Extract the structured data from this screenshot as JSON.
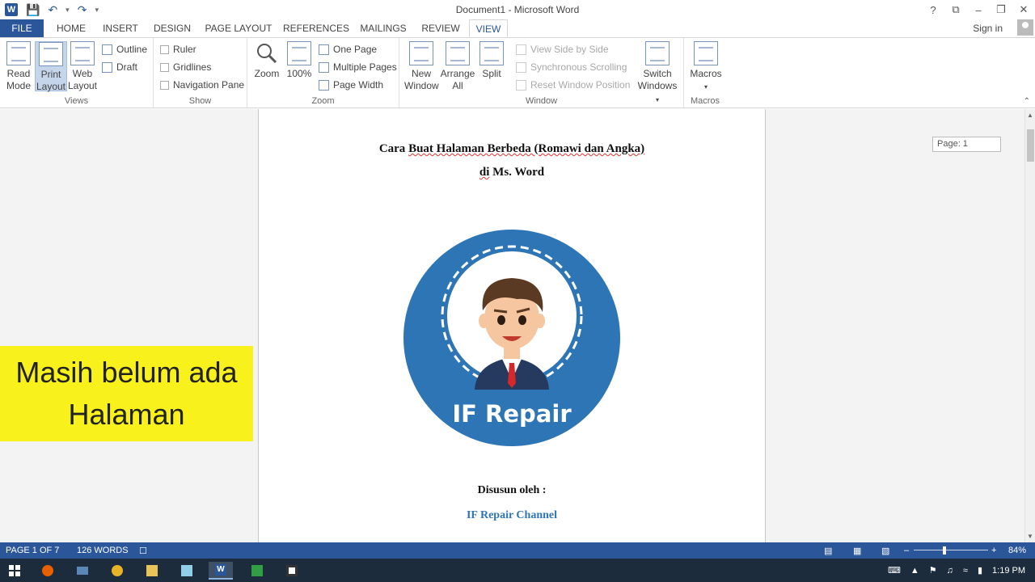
{
  "window": {
    "title": "Document1 - Microsoft Word"
  },
  "window_controls": [
    "?",
    "⧉",
    "–",
    "❐",
    "✕"
  ],
  "tabs": [
    "FILE",
    "HOME",
    "INSERT",
    "DESIGN",
    "PAGE LAYOUT",
    "REFERENCES",
    "MAILINGS",
    "REVIEW",
    "VIEW"
  ],
  "active_tab": "VIEW",
  "account": {
    "sign_in": "Sign in"
  },
  "ribbon": {
    "views": {
      "label": "Views",
      "read_mode_1": "Read",
      "read_mode_2": "Mode",
      "print_layout_1": "Print",
      "print_layout_2": "Layout",
      "web_layout_1": "Web",
      "web_layout_2": "Layout",
      "outline": "Outline",
      "draft": "Draft"
    },
    "show": {
      "label": "Show",
      "ruler": "Ruler",
      "gridlines": "Gridlines",
      "navigation_pane": "Navigation Pane"
    },
    "zoom": {
      "label": "Zoom",
      "zoom": "Zoom",
      "hundred": "100%",
      "one_page": "One Page",
      "multiple_pages": "Multiple Pages",
      "page_width": "Page Width"
    },
    "window": {
      "label": "Window",
      "new_window_1": "New",
      "new_window_2": "Window",
      "arrange_all_1": "Arrange",
      "arrange_all_2": "All",
      "split": "Split",
      "view_side_by_side": "View Side by Side",
      "synchronous_scrolling": "Synchronous Scrolling",
      "reset_window_position": "Reset Window Position",
      "switch_windows_1": "Switch",
      "switch_windows_2": "Windows"
    },
    "macros": {
      "label": "Macros",
      "macros": "Macros"
    }
  },
  "document": {
    "title_line1_a": "Cara ",
    "title_line1_b": "Buat Halaman Berbeda (Romawi dan Angka)",
    "title_line2_a": "di",
    "title_line2_b": " Ms. Word",
    "logo_text": "IF Repair",
    "disusun": "Disusun oleh :",
    "channel": "IF Repair Channel"
  },
  "page_tooltip": "Page: 1",
  "overlay": {
    "line1": "Masih belum ada",
    "line2": "Halaman"
  },
  "status": {
    "page": "PAGE 1 OF 7",
    "words": "126 WORDS",
    "zoom": "84%"
  },
  "taskbar": {
    "time": "1:19 PM"
  },
  "colors": {
    "word_blue": "#2b579a",
    "logo_blue": "#2e75b6",
    "banner_yellow": "#f8f11c",
    "taskbar": "#1c2c3c"
  }
}
